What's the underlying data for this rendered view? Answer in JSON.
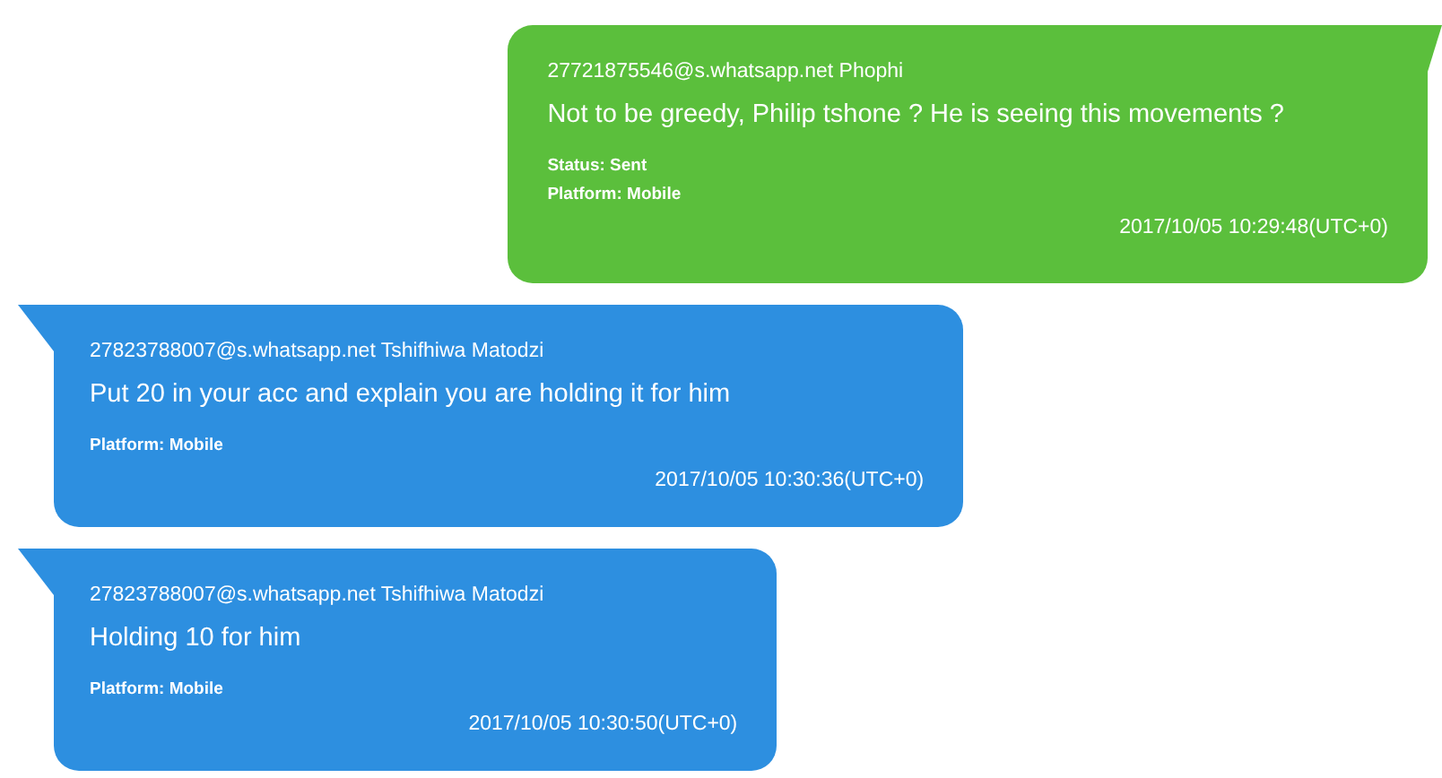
{
  "messages": [
    {
      "kind": "outgoing",
      "sender": "27721875546@s.whatsapp.net Phophi",
      "text": "Not to be greedy, Philip tshone ? He is seeing this movements ?",
      "status": "Status: Sent",
      "platform": "Platform: Mobile",
      "timestamp": "2017/10/05 10:29:48(UTC+0)"
    },
    {
      "kind": "incoming",
      "sender": "27823788007@s.whatsapp.net Tshifhiwa Matodzi",
      "text": "Put 20 in your acc and explain you are holding it for him",
      "platform": "Platform: Mobile",
      "timestamp": "2017/10/05 10:30:36(UTC+0)"
    },
    {
      "kind": "incoming",
      "sender": "27823788007@s.whatsapp.net Tshifhiwa Matodzi",
      "text": "Holding 10 for him",
      "platform": "Platform: Mobile",
      "timestamp": "2017/10/05 10:30:50(UTC+0)"
    }
  ]
}
